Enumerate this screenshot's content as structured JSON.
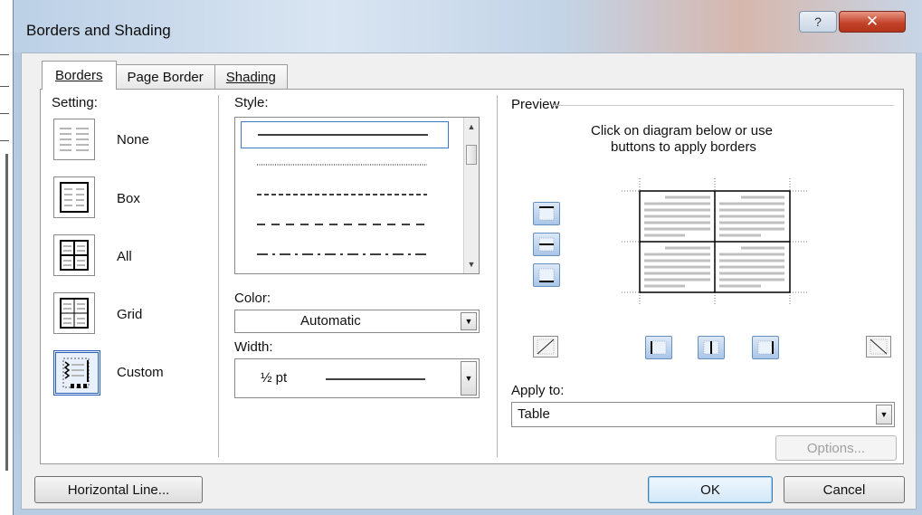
{
  "window": {
    "title": "Borders and Shading",
    "help_glyph": "?",
    "close_glyph": "✕"
  },
  "tabs": [
    {
      "label": "Borders",
      "active": true
    },
    {
      "label": "Page Border",
      "active": false
    },
    {
      "label": "Shading",
      "active": false
    }
  ],
  "setting": {
    "label": "Setting:",
    "options": [
      {
        "label": "None",
        "icon": "setting-none-icon",
        "selected": false
      },
      {
        "label": "Box",
        "icon": "setting-box-icon",
        "selected": false
      },
      {
        "label": "All",
        "icon": "setting-all-icon",
        "selected": false
      },
      {
        "label": "Grid",
        "icon": "setting-grid-icon",
        "selected": false
      },
      {
        "label": "Custom",
        "icon": "setting-custom-icon",
        "selected": true
      }
    ]
  },
  "style": {
    "label": "Style:",
    "items": [
      "solid",
      "dotted",
      "dashed-small",
      "dashed-large",
      "dash-dot"
    ],
    "selected": "solid"
  },
  "color": {
    "label": "Color:",
    "value": "Automatic"
  },
  "width": {
    "label": "Width:",
    "value": "½ pt"
  },
  "preview": {
    "label": "Preview",
    "hint_line1": "Click on diagram below or use",
    "hint_line2": "buttons to apply borders"
  },
  "apply_to": {
    "label": "Apply to:",
    "value": "Table"
  },
  "buttons": {
    "options": "Options...",
    "horizontal_line": "Horizontal Line...",
    "ok": "OK",
    "cancel": "Cancel"
  },
  "colors": {
    "accent_blue": "#3c7fb1",
    "close_red": "#c4452c"
  }
}
